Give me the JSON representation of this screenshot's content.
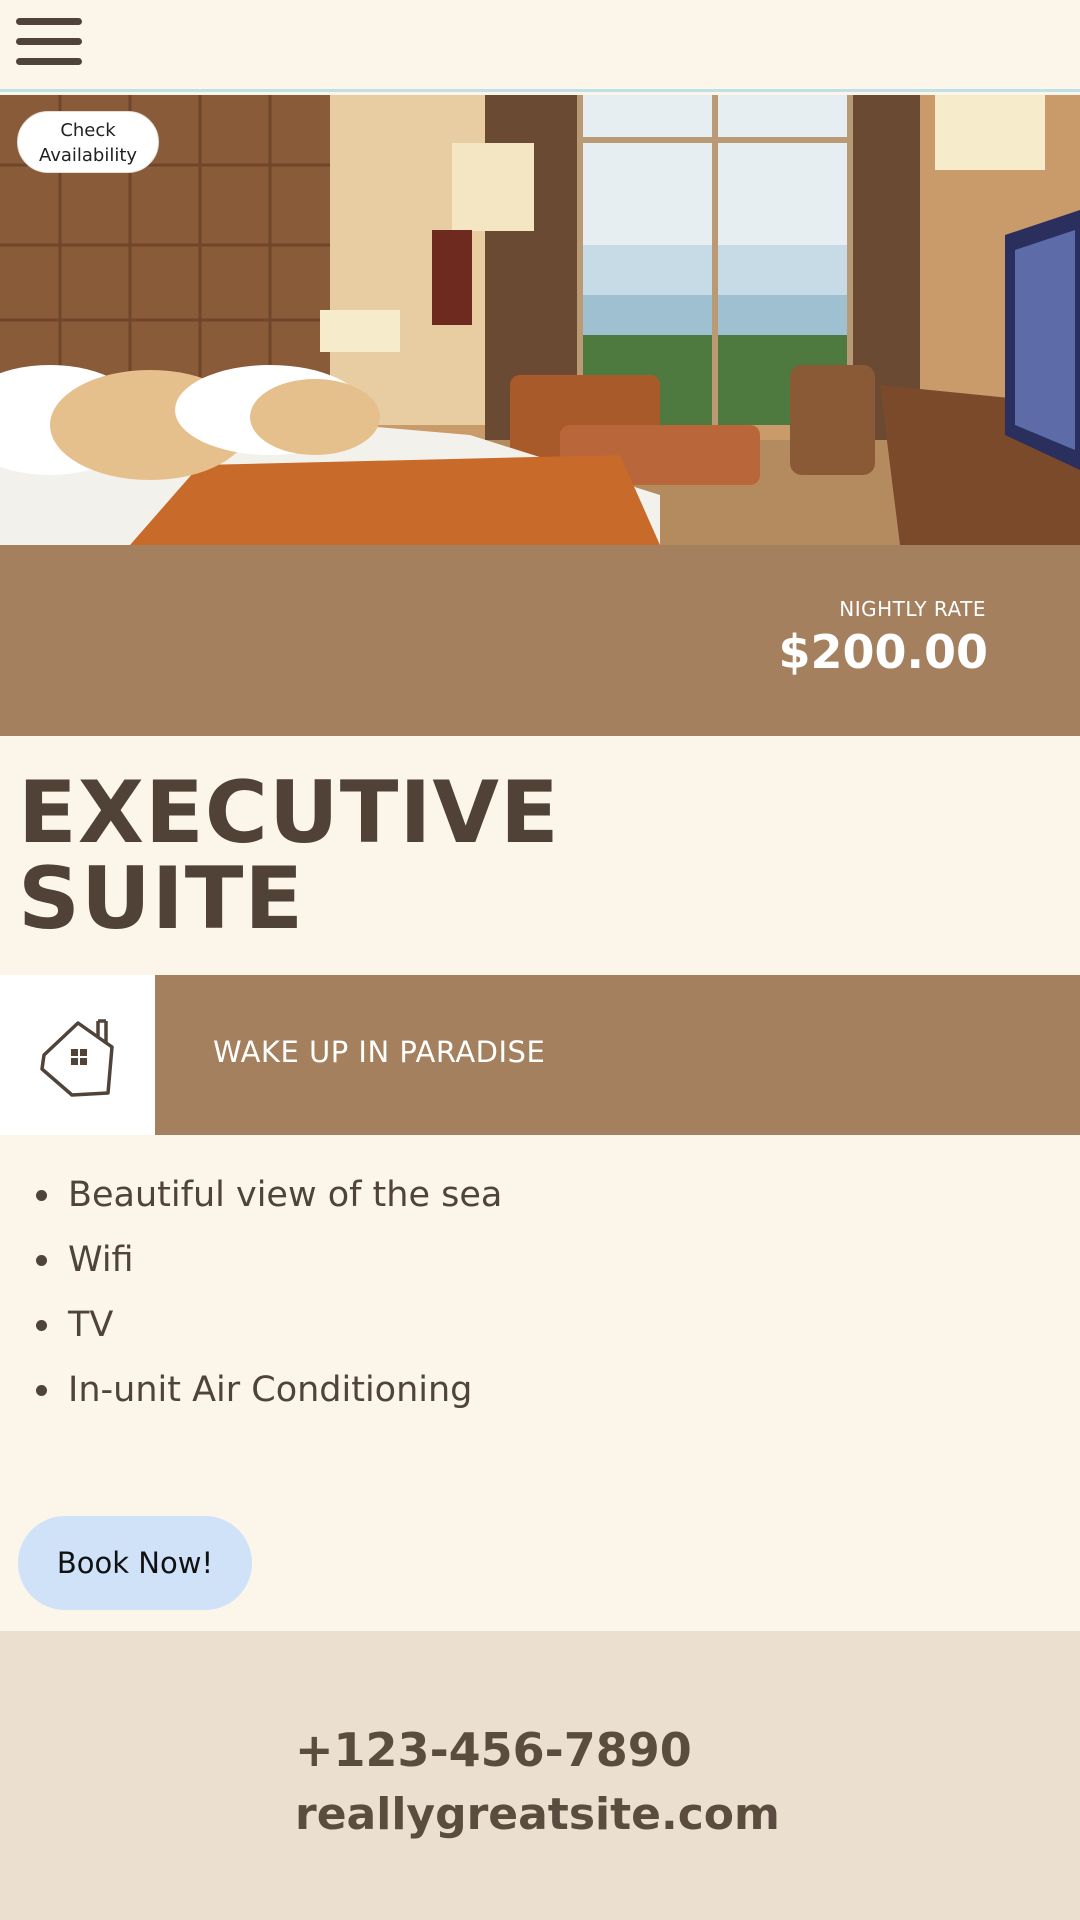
{
  "header": {
    "menu_icon": "hamburger-menu-icon"
  },
  "hero": {
    "image": "hotel-room-photo",
    "check_availability_label": "Check Availability"
  },
  "rate": {
    "label": "NIGHTLY RATE",
    "value": "$200.00"
  },
  "room": {
    "title_line1": "EXECUTIVE",
    "title_line2": "SUITE"
  },
  "tag": {
    "icon": "house-icon",
    "text": "WAKE UP IN PARADISE"
  },
  "features": [
    "Beautiful view of the sea",
    "Wifi",
    "TV",
    "In-unit Air Conditioning"
  ],
  "cta": {
    "book_label": "Book Now!"
  },
  "footer": {
    "phone": "+123-456-7890",
    "website": "reallygreatsite.com"
  },
  "colors": {
    "page_bg": "#fcf5ea",
    "accent_brown": "#a4805e",
    "text_dark": "#4f433a",
    "button_blue": "#cfe2f8",
    "footer_bg": "#ebe0d0"
  }
}
